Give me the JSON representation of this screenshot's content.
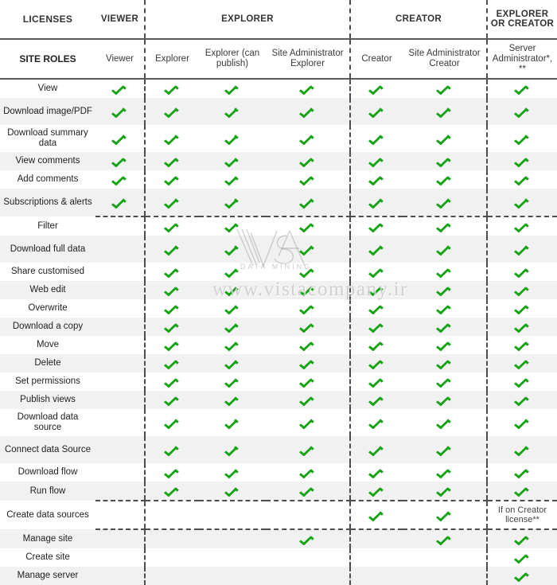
{
  "table": {
    "corner_license_label": "LICENSES",
    "corner_roles_label": "SITE ROLES",
    "license_groups": [
      {
        "label": "VIEWER"
      },
      {
        "label": "EXPLORER"
      },
      {
        "label": "CREATOR"
      },
      {
        "label": "EXPLORER OR CREATOR"
      }
    ],
    "columns": [
      {
        "key": "viewer",
        "label": "Viewer"
      },
      {
        "key": "explorer",
        "label": "Explorer"
      },
      {
        "key": "explorer_pub",
        "label": "Explorer (can publish)"
      },
      {
        "key": "site_admin_explorer",
        "label": "Site Administrator Explorer"
      },
      {
        "key": "creator",
        "label": "Creator"
      },
      {
        "key": "site_admin_creator",
        "label": "Site Administrator Creator"
      },
      {
        "key": "server_admin",
        "label": "Server Administrator*, **"
      }
    ],
    "rows": [
      {
        "label": "View",
        "cells": [
          "check",
          "check",
          "check",
          "check",
          "check",
          "check",
          "check"
        ]
      },
      {
        "label": "Download image/PDF",
        "cells": [
          "check",
          "check",
          "check",
          "check",
          "check",
          "check",
          "check"
        ]
      },
      {
        "label": "Download summary data",
        "cells": [
          "check",
          "check",
          "check",
          "check",
          "check",
          "check",
          "check"
        ]
      },
      {
        "label": "View comments",
        "cells": [
          "check",
          "check",
          "check",
          "check",
          "check",
          "check",
          "check"
        ]
      },
      {
        "label": "Add comments",
        "cells": [
          "check",
          "check",
          "check",
          "check",
          "check",
          "check",
          "check"
        ]
      },
      {
        "label": "Subscriptions & alerts",
        "cells": [
          "check",
          "check",
          "check",
          "check",
          "check",
          "check",
          "check"
        ]
      },
      {
        "label": "Filter",
        "cells": [
          "",
          "check",
          "check",
          "check",
          "check",
          "check",
          "check"
        ]
      },
      {
        "label": "Download full data",
        "cells": [
          "",
          "check",
          "check",
          "check",
          "check",
          "check",
          "check"
        ]
      },
      {
        "label": "Share customised",
        "cells": [
          "",
          "check",
          "check",
          "check",
          "check",
          "check",
          "check"
        ]
      },
      {
        "label": "Web edit",
        "cells": [
          "",
          "check",
          "check",
          "check",
          "check",
          "check",
          "check"
        ]
      },
      {
        "label": "Overwrite",
        "cells": [
          "",
          "check",
          "check",
          "check",
          "check",
          "check",
          "check"
        ]
      },
      {
        "label": "Download a copy",
        "cells": [
          "",
          "check",
          "check",
          "check",
          "check",
          "check",
          "check"
        ]
      },
      {
        "label": "Move",
        "cells": [
          "",
          "check",
          "check",
          "check",
          "check",
          "check",
          "check"
        ]
      },
      {
        "label": "Delete",
        "cells": [
          "",
          "check",
          "check",
          "check",
          "check",
          "check",
          "check"
        ]
      },
      {
        "label": "Set permissions",
        "cells": [
          "",
          "check",
          "check",
          "check",
          "check",
          "check",
          "check"
        ]
      },
      {
        "label": "Publish views",
        "cells": [
          "",
          "check",
          "check",
          "check",
          "check",
          "check",
          "check"
        ]
      },
      {
        "label": "Download data source",
        "cells": [
          "",
          "check",
          "check",
          "check",
          "check",
          "check",
          "check"
        ]
      },
      {
        "label": "Connect data Source",
        "cells": [
          "",
          "check",
          "check",
          "check",
          "check",
          "check",
          "check"
        ]
      },
      {
        "label": "Download flow",
        "cells": [
          "",
          "check",
          "check",
          "check",
          "check",
          "check",
          "check"
        ]
      },
      {
        "label": "Run flow",
        "cells": [
          "",
          "check",
          "check",
          "check",
          "check",
          "check",
          "check"
        ]
      },
      {
        "label": "Create data sources",
        "cells": [
          "",
          "",
          "",
          "",
          "check",
          "check",
          "If on Creator license**"
        ]
      },
      {
        "label": "Manage site",
        "cells": [
          "",
          "",
          "",
          "check",
          "",
          "check",
          "check"
        ]
      },
      {
        "label": "Create site",
        "cells": [
          "",
          "",
          "",
          "",
          "",
          "",
          "check"
        ]
      },
      {
        "label": "Manage server",
        "cells": [
          "",
          "",
          "",
          "",
          "",
          "",
          "check"
        ]
      }
    ]
  },
  "watermark": {
    "brand": "VISTA",
    "tagline": "DATA MINING",
    "url": "www.vistacompany.ir"
  },
  "colors": {
    "check_green": "#13a313",
    "row_alt": "#f1f1f1",
    "rule": "#595959",
    "dashed": "#4d4d4d"
  }
}
